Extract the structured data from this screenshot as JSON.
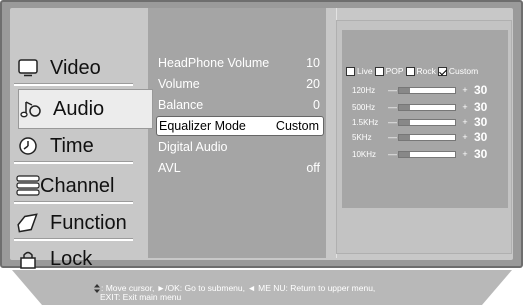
{
  "sidebar": {
    "items": [
      {
        "label": "Video",
        "icon": "monitor-icon"
      },
      {
        "label": "Audio",
        "icon": "music-note-icon"
      },
      {
        "label": "Time",
        "icon": "clock-icon"
      },
      {
        "label": "Channel",
        "icon": "channel-stack-icon"
      },
      {
        "label": "Function",
        "icon": "diamond-icon"
      },
      {
        "label": "Lock",
        "icon": "lock-icon"
      }
    ],
    "active": "Audio"
  },
  "audio_menu": {
    "rows": [
      {
        "label": "HeadPhone Volume",
        "value": "10"
      },
      {
        "label": "Volume",
        "value": "20"
      },
      {
        "label": "Balance",
        "value": "0"
      },
      {
        "label": "Equalizer Mode",
        "value": "Custom"
      },
      {
        "label": "Digital Audio",
        "value": ""
      },
      {
        "label": "AVL",
        "value": "off"
      }
    ],
    "selected": "Equalizer Mode"
  },
  "equalizer": {
    "modes": [
      {
        "label": "Live",
        "checked": false
      },
      {
        "label": "POP",
        "checked": false
      },
      {
        "label": "Rock",
        "checked": false
      },
      {
        "label": "Custom",
        "checked": true
      }
    ],
    "bands": [
      {
        "freq": "120Hz",
        "minus": "—",
        "plus": "+",
        "value": "30",
        "level": 0.2
      },
      {
        "freq": "500Hz",
        "minus": "—",
        "plus": "+",
        "value": "30",
        "level": 0.2
      },
      {
        "freq": "1.5KHz",
        "minus": "—",
        "plus": "+",
        "value": "30",
        "level": 0.2
      },
      {
        "freq": "5KHz",
        "minus": "—",
        "plus": "+",
        "value": "30",
        "level": 0.2
      },
      {
        "freq": "10KHz",
        "minus": "—",
        "plus": "+",
        "value": "30",
        "level": 0.2
      }
    ]
  },
  "help": {
    "line1": ": Move cursor,  ►/OK: Go to submenu,  ◄ ME NU: Return to upper menu,",
    "line2": "EXIT: Exit main menu"
  }
}
